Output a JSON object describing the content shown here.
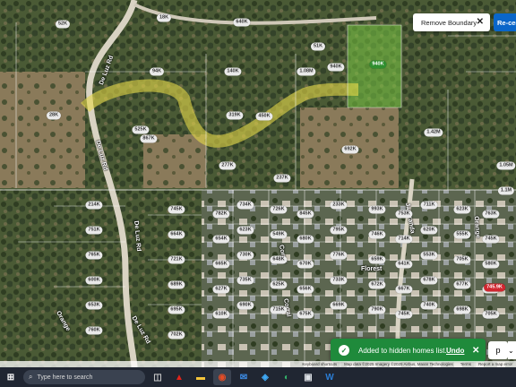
{
  "buttons": {
    "remove_boundary": "Remove Boundary",
    "recenter": "Re-center",
    "map_layers": "p"
  },
  "roads": [
    "De Luz Rd",
    "De Luz Rd",
    "De Luz Rd",
    "De Luz Rd",
    "Florest",
    "Corral",
    "Corral",
    "Jacaranda",
    "Orange",
    "Orange"
  ],
  "watermark": "CR",
  "pins_top": [
    "52K",
    "18K",
    "640K",
    "94K",
    "140K",
    "1.08M",
    "940K",
    "28K",
    "525K",
    "319K",
    "450K",
    "867K",
    "277K",
    "237K",
    "692K",
    "51K",
    "1.42M",
    "1.05M",
    "1.1M"
  ],
  "pins_bottom": [
    "214K",
    "745K",
    "782K",
    "734K",
    "726K",
    "845K",
    "233K",
    "993K",
    "753K",
    "711K",
    "623K",
    "763K",
    "751K",
    "664K",
    "654K",
    "623K",
    "549K",
    "680K",
    "795K",
    "746K",
    "714K",
    "620K",
    "555K",
    "745K",
    "765K",
    "721K",
    "665K",
    "730K",
    "648K",
    "670K",
    "776K",
    "659K",
    "641K",
    "553K",
    "705K",
    "580K",
    "600K",
    "689K",
    "627K",
    "735K",
    "625K",
    "656K",
    "733K",
    "672K",
    "667K",
    "678K",
    "677K",
    "645K",
    "653K",
    "695K",
    "610K",
    "690K",
    "715K",
    "675K",
    "669K",
    "790K",
    "745K",
    "740K",
    "698K",
    "705K",
    "760K",
    "702K"
  ],
  "pin_green": "940K",
  "pin_red": "745.9K",
  "toast": {
    "message": "Added to hidden homes list.",
    "undo": "Undo"
  },
  "attribution": [
    "Keyboard shortcuts",
    "Map data ©2025 Imagery ©2025 Airbus, Maxar Technologies",
    "Terms",
    "Report a map error"
  ],
  "taskbar": {
    "search_placeholder": "Type here to search"
  },
  "colors": {
    "toast_green": "#1f8a3b",
    "recenter_blue": "#0a66c9",
    "boundary_yellow": "#e6d84a",
    "selected_parcel": "#7ac943"
  }
}
